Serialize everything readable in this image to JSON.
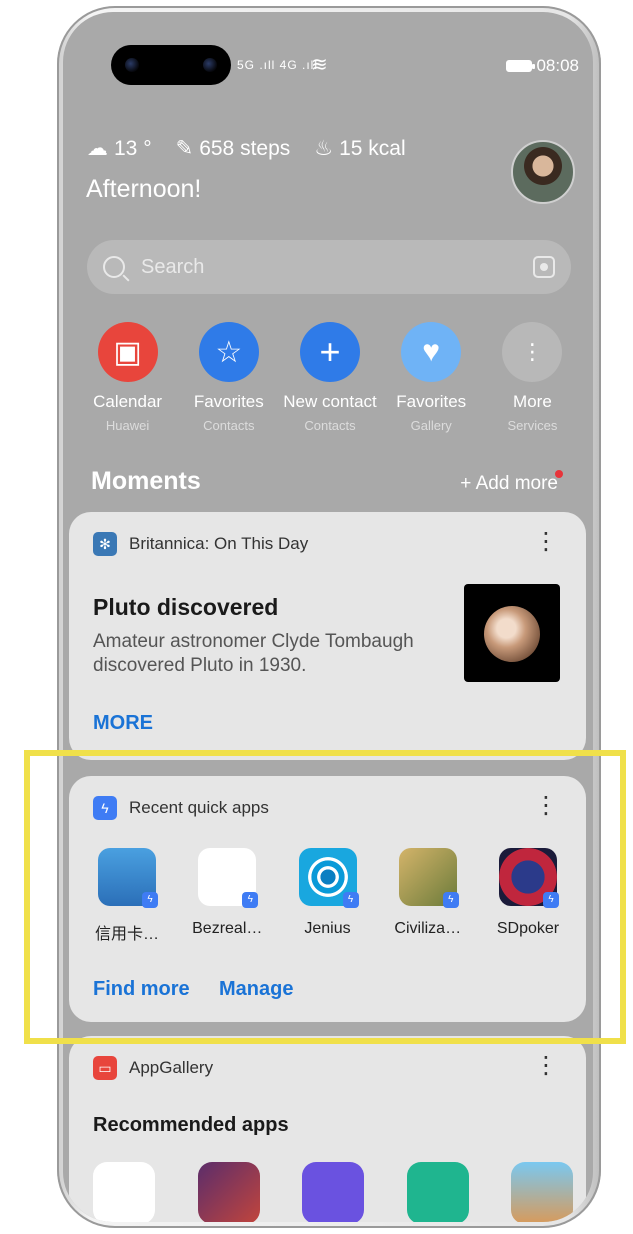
{
  "status": {
    "signal_left": "5G .ıll 4G .ıll",
    "time": "08:08"
  },
  "stats": {
    "weather": "13 °",
    "steps": "658 steps",
    "kcal": "15 kcal"
  },
  "greeting": "Afternoon!",
  "search": {
    "placeholder": "Search"
  },
  "shortcuts": [
    {
      "label": "Calendar",
      "sub": "Huawei",
      "color": "#e8453c",
      "icon": "calendar-icon"
    },
    {
      "label": "Favorites",
      "sub": "Contacts",
      "color": "#2f7be8",
      "icon": "star-icon"
    },
    {
      "label": "New contact",
      "sub": "Contacts",
      "color": "#2f7be8",
      "icon": "plus-icon"
    },
    {
      "label": "Favorites",
      "sub": "Gallery",
      "color": "#6fb3f6",
      "icon": "heart-icon"
    },
    {
      "label": "More",
      "sub": "Services",
      "color": "#b8b8b8",
      "icon": "more-icon"
    }
  ],
  "moments": {
    "title": "Moments",
    "add_more": "+ Add more"
  },
  "britannica": {
    "source": "Britannica: On This Day",
    "title": "Pluto discovered",
    "desc": "Amateur astronomer Clyde Tombaugh discovered Pluto in 1930.",
    "more": "MORE"
  },
  "quick_apps": {
    "header": "Recent quick apps",
    "apps": [
      {
        "name": "信用卡…",
        "icon": "bank-icon"
      },
      {
        "name": "Bezreal…",
        "icon": "location-pin-icon"
      },
      {
        "name": "Jenius",
        "icon": "jenius-icon"
      },
      {
        "name": "Civiliza…",
        "icon": "statue-icon"
      },
      {
        "name": "SDpoker",
        "icon": "poker-chip-icon"
      }
    ],
    "find_more": "Find more",
    "manage": "Manage"
  },
  "appgallery": {
    "header": "AppGallery",
    "title": "Recommended apps"
  },
  "colors": {
    "accent": "#1a73d6",
    "highlight": "#f0e04a"
  }
}
